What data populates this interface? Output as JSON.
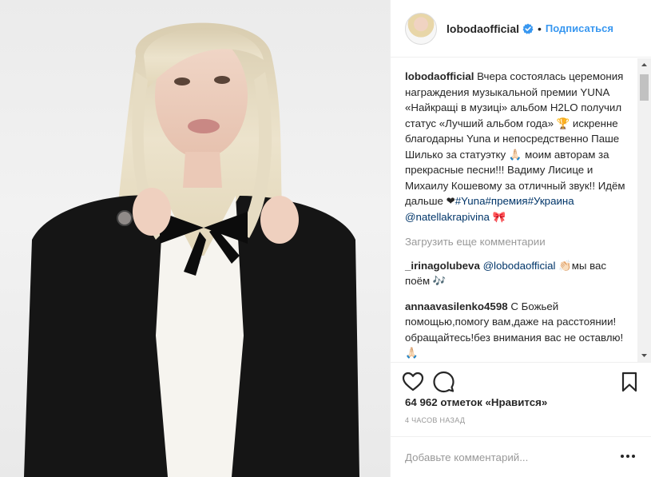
{
  "post": {
    "username": "lobodaofficial",
    "follow_label": "Подписаться",
    "separator": "•",
    "caption": {
      "username": "lobodaofficial",
      "text_1": " Вчера состоялась церемония награждения музыкальной премии YUNA «Найкращі в музиці» альбом H2LO получил статус «Лучший альбом года» 🏆 искренне благодарны Yuna и непосредственно Паше Шилько за статуэтку 🙏🏻 моим авторам за прекрасные песни!!! Вадиму Лисице и Михаилу Кошевому за отличный звук!! Идём дальше ❤",
      "tag_1": "#Yuna",
      "tag_2": "#премия",
      "tag_3": "#Украина",
      "mention": "@natellakrapivina",
      "text_2": " 🎀"
    },
    "load_more": "Загрузить еще комментарии",
    "comments": [
      {
        "user": "_irinagolubeva",
        "mention": "@lobodaofficial",
        "text": " 👏🏻мы вас поём 🎶"
      },
      {
        "user": "annaavasilenko4598",
        "mention": "",
        "text": " С Божьей помощью,помогу вам,даже на расстоянии!обращайтесь!без внимания вас не оставлю!🙏🏻"
      }
    ],
    "likes": "64 962 отметок «Нравится»",
    "time": "4 часов назад",
    "add_comment_placeholder": "Добавьте комментарий..."
  },
  "colors": {
    "link": "#3897f0",
    "tag": "#003569",
    "muted": "#999999",
    "border": "#efefef"
  }
}
